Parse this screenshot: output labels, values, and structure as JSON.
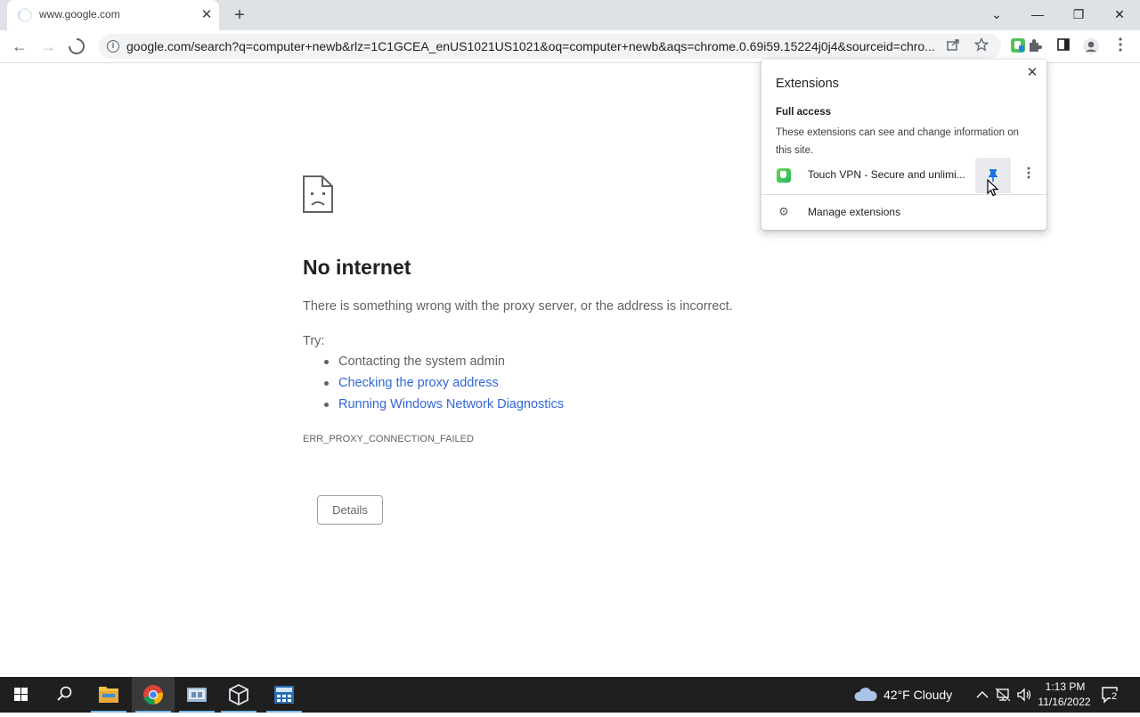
{
  "tab": {
    "title": "www.google.com",
    "close_symbol": "✕",
    "new_tab_symbol": "+"
  },
  "window_controls": {
    "dropdown": "⌄",
    "minimize": "—",
    "restore": "❐",
    "close": "✕"
  },
  "toolbar": {
    "back": "←",
    "forward": "→",
    "url": "google.com/search?q=computer+newb&rlz=1C1GCEA_enUS1021US1021&oq=computer+newb&aqs=chrome.0.69i59.15224j0j4&sourceid=chro...",
    "icons": [
      "info-icon",
      "share-icon",
      "star-icon",
      "touch-vpn-extension-icon",
      "puzzle-extensions-icon",
      "side-panel-icon",
      "profile-icon",
      "kebab-menu-icon"
    ]
  },
  "error_page": {
    "title": "No internet",
    "description": "There is something wrong with the proxy server, or the address is incorrect.",
    "try_label": "Try:",
    "suggestions": [
      {
        "text": "Contacting the system admin",
        "link": false
      },
      {
        "text": "Checking the proxy address",
        "link": true
      },
      {
        "text": "Running Windows Network Diagnostics",
        "link": true
      }
    ],
    "error_code": "ERR_PROXY_CONNECTION_FAILED",
    "details_button": "Details"
  },
  "extensions_popup": {
    "title": "Extensions",
    "close_symbol": "✕",
    "section_title": "Full access",
    "section_description": "These extensions can see and change information on this site.",
    "extension_name": "Touch VPN - Secure and unlimi...",
    "manage_label": "Manage extensions"
  },
  "taskbar": {
    "apps": [
      "start",
      "search",
      "file-explorer",
      "chrome",
      "control-panel",
      "virtualbox",
      "calculator"
    ],
    "weather": "42°F  Cloudy",
    "time": "1:13 PM",
    "date": "11/16/2022",
    "notifications": "2"
  },
  "colors": {
    "link": "#3367d6",
    "accent": "#1a73e8",
    "taskbar": "#1f1f1f"
  }
}
